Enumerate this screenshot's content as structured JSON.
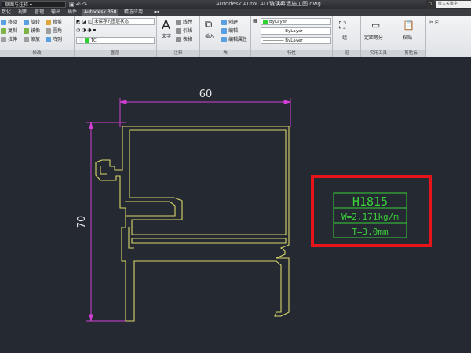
{
  "window": {
    "workspace": "草图与注释",
    "app_title": "Autodesk AutoCAD 2014",
    "file_name": "玻璃幕墙施工图.dwg",
    "search_placeholder": "键入关键字"
  },
  "tabs": [
    {
      "label": "数化"
    },
    {
      "label": "视图"
    },
    {
      "label": "管理"
    },
    {
      "label": "输出"
    },
    {
      "label": "插件"
    },
    {
      "label": "Autodesk 360"
    },
    {
      "label": "精选应用"
    }
  ],
  "ribbon": {
    "modify": {
      "label": "修改",
      "items": [
        "移动",
        "旋转",
        "修剪",
        "复制",
        "镜像",
        "圆角",
        "拉伸",
        "缩放",
        "阵列"
      ]
    },
    "layers": {
      "label": "图层",
      "layer_state": "未保存的图层状态",
      "current_layer": "TC"
    },
    "annotation": {
      "label": "注释",
      "text": "文字",
      "items": [
        "线性",
        "引线",
        "表格"
      ]
    },
    "block": {
      "label": "块",
      "insert": "插入",
      "items": [
        "创建",
        "编辑",
        "编辑属性"
      ]
    },
    "properties": {
      "label": "特性",
      "color": "ByLayer",
      "linetype": "ByLayer",
      "lineweight": "ByLayer",
      "accent": "#2fd12f"
    },
    "groups": {
      "label": "组",
      "item": "组"
    },
    "utilities": {
      "label": "实用工具",
      "item": "定距等分"
    },
    "clipboard": {
      "label": "剪贴板",
      "item": "粘贴"
    }
  },
  "drawing": {
    "dim_width": "60",
    "dim_height": "70",
    "profile_color": "#d9d86a",
    "dim_color": "#d23fd6",
    "info_color": "#39d439",
    "info": {
      "code": "H1815",
      "weight": "W=2.171kg/m",
      "thickness": "T=3.0mm"
    }
  }
}
